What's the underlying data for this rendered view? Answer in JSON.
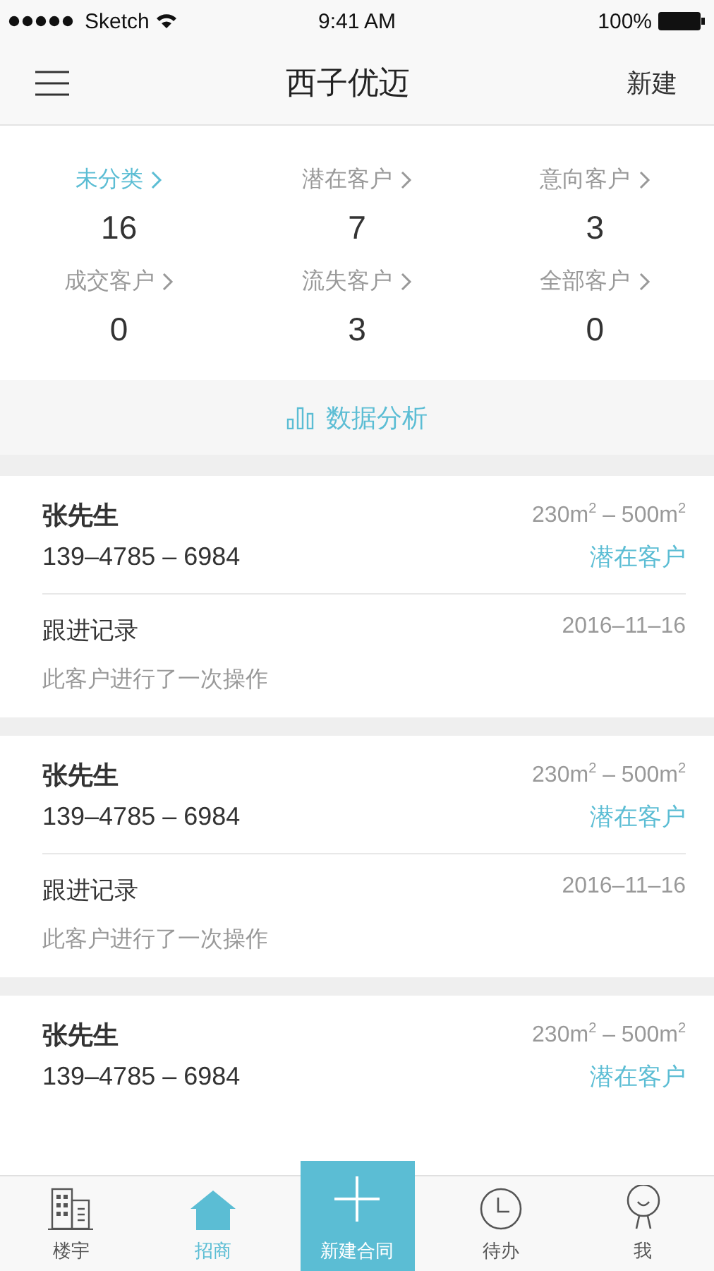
{
  "status_bar": {
    "carrier": "Sketch",
    "time": "9:41 AM",
    "battery": "100%"
  },
  "nav": {
    "title": "西子优迈",
    "action": "新建"
  },
  "categories": [
    {
      "label": "未分类",
      "count": "16",
      "selected": true
    },
    {
      "label": "潜在客户",
      "count": "7",
      "selected": false
    },
    {
      "label": "意向客户",
      "count": "3",
      "selected": false
    },
    {
      "label": "成交客户",
      "count": "0",
      "selected": false
    },
    {
      "label": "流失客户",
      "count": "3",
      "selected": false
    },
    {
      "label": "全部客户",
      "count": "0",
      "selected": false
    }
  ],
  "analysis": {
    "label": "数据分析"
  },
  "customers": [
    {
      "name": "张先生",
      "phone": "139–4785 – 6984",
      "area": "230m$^{2}$ – 500m$^{2}$",
      "status": "潜在客户",
      "follow_title": "跟进记录",
      "follow_date": "2016–11–16",
      "follow_text": "此客户进行了一次操作"
    },
    {
      "name": "张先生",
      "phone": "139–4785 – 6984",
      "area": "230m$^{2}$ – 500m$^{2}$",
      "status": "潜在客户",
      "follow_title": "跟进记录",
      "follow_date": "2016–11–16",
      "follow_text": "此客户进行了一次操作"
    },
    {
      "name": "张先生",
      "phone": "139–4785 – 6984",
      "area": "230m$^{2}$ – 500m$^{2}$",
      "status": "潜在客户"
    }
  ],
  "tabs": [
    {
      "kind": "building",
      "label": "楼宇",
      "selected": false
    },
    {
      "kind": "house",
      "label": "招商",
      "selected": true
    },
    {
      "kind": "plus",
      "label": "新建合同",
      "selected": false
    },
    {
      "kind": "clock",
      "label": "待办",
      "selected": false
    },
    {
      "kind": "person",
      "label": "我",
      "selected": false
    }
  ]
}
